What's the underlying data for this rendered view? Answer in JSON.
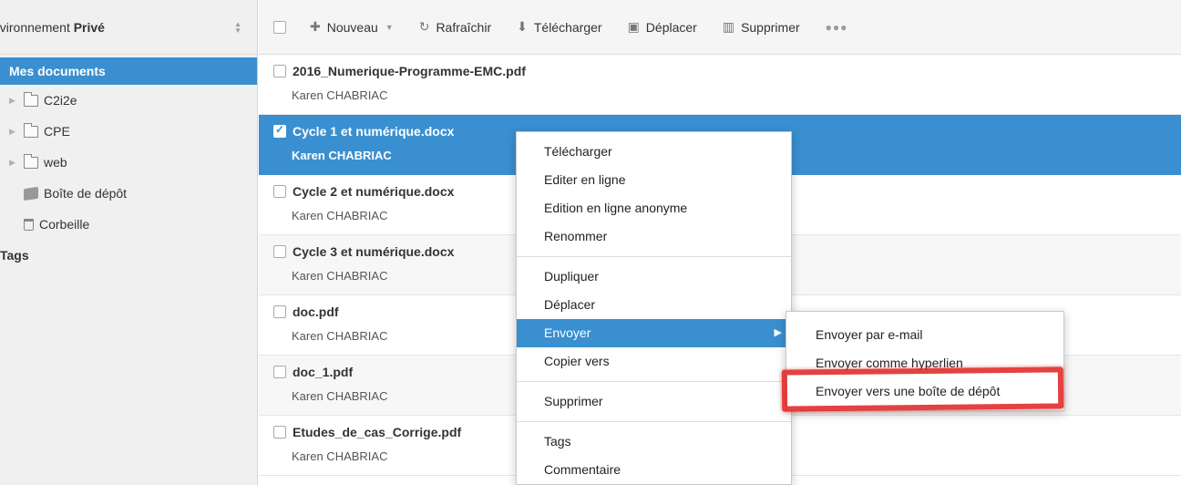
{
  "sidebar": {
    "env_label": "nvironnement",
    "env_value": "Privé",
    "items": [
      {
        "label": "Mes documents"
      },
      {
        "label": "C2i2e"
      },
      {
        "label": "CPE"
      },
      {
        "label": "web"
      },
      {
        "label": "Boîte de dépôt"
      },
      {
        "label": "Corbeille"
      },
      {
        "label": "Tags"
      }
    ]
  },
  "toolbar": {
    "new_label": "Nouveau",
    "refresh_label": "Rafraîchir",
    "download_label": "Télécharger",
    "move_label": "Déplacer",
    "delete_label": "Supprimer",
    "more_label": "●●●"
  },
  "files": [
    {
      "name": "2016_Numerique-Programme-EMC.pdf",
      "owner": "Karen CHABRIAC"
    },
    {
      "name": "Cycle 1 et numérique.docx",
      "owner": "Karen CHABRIAC"
    },
    {
      "name": "Cycle 2 et numérique.docx",
      "owner": "Karen CHABRIAC"
    },
    {
      "name": "Cycle 3 et numérique.docx",
      "owner": "Karen CHABRIAC"
    },
    {
      "name": "doc.pdf",
      "owner": "Karen CHABRIAC"
    },
    {
      "name": "doc_1.pdf",
      "owner": "Karen CHABRIAC"
    },
    {
      "name": "Etudes_de_cas_Corrige.pdf",
      "owner": "Karen CHABRIAC"
    }
  ],
  "context_menu": {
    "group1": [
      "Télécharger",
      "Editer en ligne",
      "Edition en ligne anonyme",
      "Renommer"
    ],
    "group2": [
      "Dupliquer",
      "Déplacer",
      "Envoyer",
      "Copier vers"
    ],
    "group3": [
      "Supprimer"
    ],
    "group4": [
      "Tags",
      "Commentaire"
    ]
  },
  "submenu": {
    "items": [
      "Envoyer par e-mail",
      "Envoyer comme hyperlien",
      "Envoyer vers une boîte de dépôt"
    ]
  },
  "colors": {
    "accent": "#3a8fd0",
    "annotation": "#e02020"
  }
}
